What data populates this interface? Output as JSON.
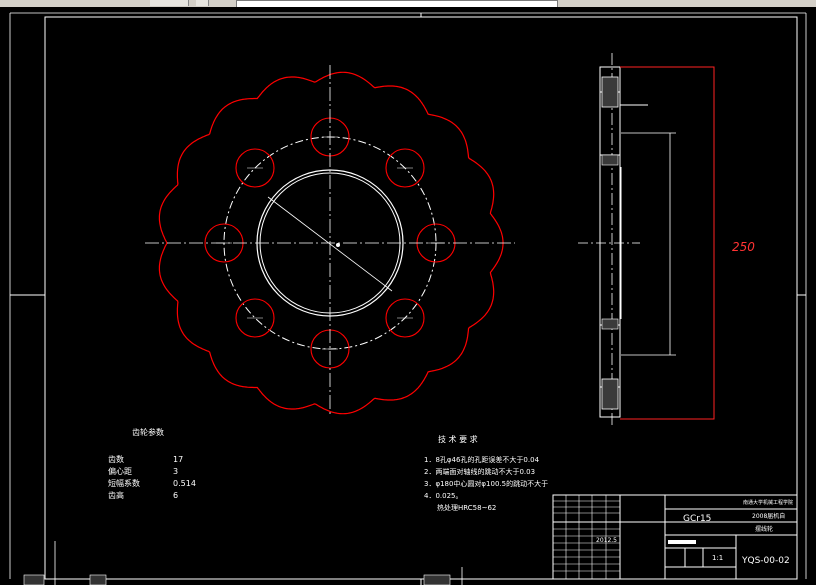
{
  "drawing": {
    "material": "GCr15",
    "drawing_number": "YQS-00-02",
    "scale": "1:1",
    "sheet_title": "摆线轮",
    "school": "南通大学机械工程学院",
    "class_code": "2008届机自",
    "date": "2012.5",
    "side_dimension": "250",
    "colors": {
      "outline": "#ff0000",
      "centerline": "#ffffff",
      "frame": "#ffffff",
      "background": "#000000",
      "dim": "#ff3333"
    }
  },
  "params": {
    "title": "齿轮参数",
    "rows": [
      {
        "label": "齿数",
        "value": "17"
      },
      {
        "label": "偏心距",
        "value": "3"
      },
      {
        "label": "短幅系数",
        "value": "0.514"
      },
      {
        "label": "齿高",
        "value": "6"
      }
    ]
  },
  "tech": {
    "title": "技 术 要 求",
    "items": [
      "1．8孔φ46孔的孔距误差不大于0.04",
      "2．两端面对轴线的跳动不大于0.03",
      "3．φ180中心圆对φ100.5的跳动不大于",
      "4．0.025。",
      "热处理HRC58~62"
    ]
  }
}
